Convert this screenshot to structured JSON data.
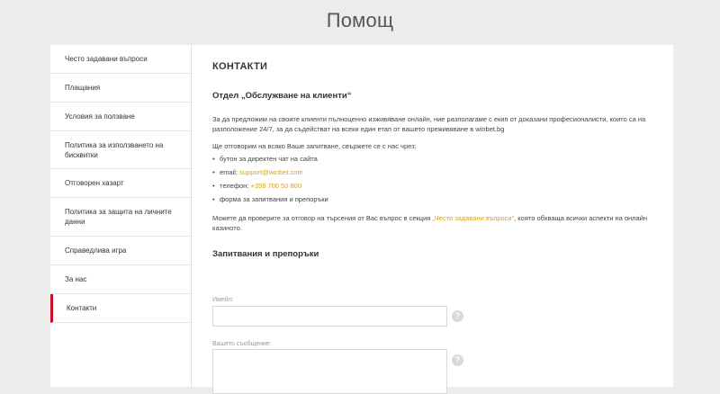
{
  "page": {
    "title": "Помощ"
  },
  "sidebar": {
    "items": [
      {
        "label": "Често задавани въпроси"
      },
      {
        "label": "Плащания"
      },
      {
        "label": "Условия за ползване"
      },
      {
        "label": "Политика за използването на бисквитки"
      },
      {
        "label": "Отговорен хазарт"
      },
      {
        "label": "Политика за защита на личните данни"
      },
      {
        "label": "Справедлива игра"
      },
      {
        "label": "За нас"
      },
      {
        "label": "Контакти",
        "active": true
      }
    ]
  },
  "content": {
    "section_title": "КОНТАКТИ",
    "department_title": "Отдел „Обслужване на клиенти“",
    "intro": "За да предложим на своите клиенти пълноценно изживяване онлайн, ние разполагаме с екип от доказани професионалисти, които са на разположение 24/7, за да съдействат на всеки един етап от вашето преживяване в winbet.bg",
    "contact_lead": "Ще отговорим на всяко Ваше запитване, свържете се с нас чрез:",
    "contacts": {
      "chat": "бутон за директен чат на сайта",
      "email_label": "email: ",
      "email_value": "support@winbet.com",
      "phone_label": "телефон: ",
      "phone_value": "+359 700 50 800",
      "form": "форма за запитвания и препоръки"
    },
    "faq_pre": "Можете да проверите за отговор на търсения от Вас въпрос в секция ",
    "faq_link": "„Често задавани въпроси“",
    "faq_post": ", която обхваща всички аспекти на онлайн казиното.",
    "form_title": "Запитвания и препоръки",
    "form": {
      "email_label": "Имейл:",
      "message_label": "Вашето съобщение:",
      "help_glyph": "?"
    }
  },
  "colors": {
    "accent": "#d4a21c",
    "active_marker": "#c8102e",
    "background": "#ececec"
  }
}
